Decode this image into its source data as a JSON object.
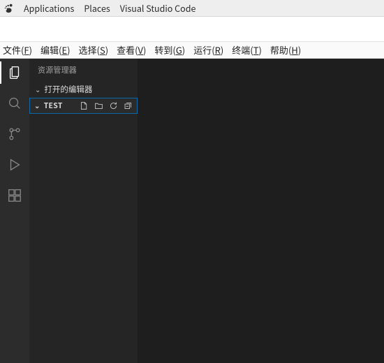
{
  "gnome": {
    "applications": "Applications",
    "places": "Places",
    "app_title": "Visual Studio Code"
  },
  "menu": {
    "file": {
      "label": "文件",
      "mn": "F"
    },
    "edit": {
      "label": "编辑",
      "mn": "E"
    },
    "select": {
      "label": "选择",
      "mn": "S"
    },
    "view": {
      "label": "查看",
      "mn": "V"
    },
    "go": {
      "label": "转到",
      "mn": "G"
    },
    "run": {
      "label": "运行",
      "mn": "R"
    },
    "term": {
      "label": "终端",
      "mn": "T"
    },
    "help": {
      "label": "帮助",
      "mn": "H"
    }
  },
  "sidebar": {
    "title": "资源管理器",
    "open_editors": "打开的编辑器",
    "folder_name": "TEST"
  }
}
